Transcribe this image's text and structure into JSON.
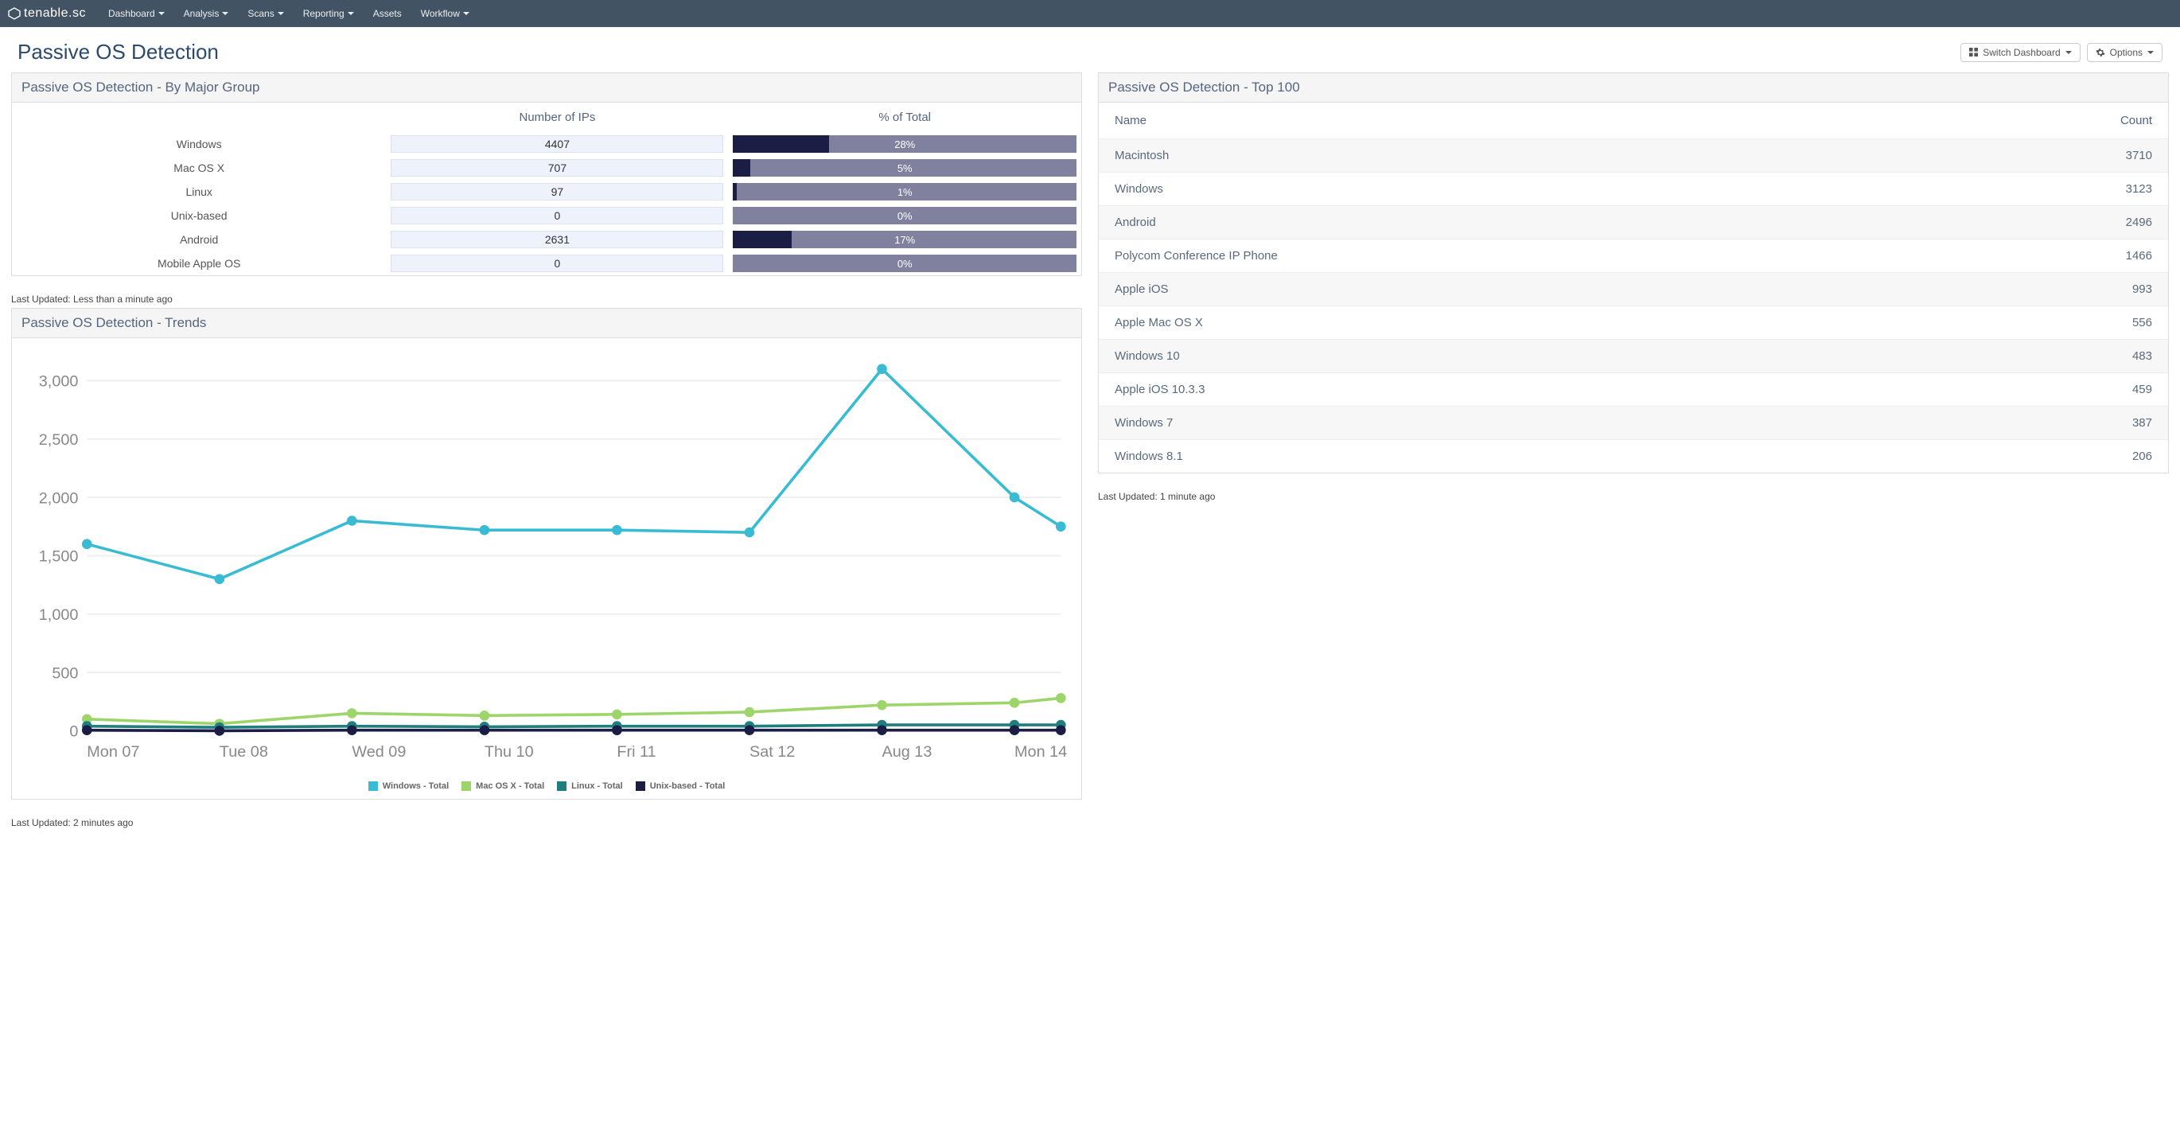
{
  "brand": "tenable.sc",
  "nav": [
    "Dashboard",
    "Analysis",
    "Scans",
    "Reporting",
    "Assets",
    "Workflow"
  ],
  "nav_has_caret": [
    true,
    true,
    true,
    true,
    false,
    true
  ],
  "page_title": "Passive OS Detection",
  "buttons": {
    "switch_dashboard": "Switch Dashboard",
    "options": "Options"
  },
  "panels": {
    "major_group_title": "Passive OS Detection - By Major Group",
    "trends_title": "Passive OS Detection - Trends",
    "top100_title": "Passive OS Detection - Top 100"
  },
  "major_group": {
    "col_ips": "Number of IPs",
    "col_pct": "% of Total",
    "rows": [
      {
        "label": "Windows",
        "ips": "4407",
        "pct": 28
      },
      {
        "label": "Mac OS X",
        "ips": "707",
        "pct": 5
      },
      {
        "label": "Linux",
        "ips": "97",
        "pct": 1
      },
      {
        "label": "Unix-based",
        "ips": "0",
        "pct": 0
      },
      {
        "label": "Android",
        "ips": "2631",
        "pct": 17
      },
      {
        "label": "Mobile Apple OS",
        "ips": "0",
        "pct": 0
      }
    ],
    "footer": "Last Updated: Less than a minute ago"
  },
  "chart_data": {
    "type": "line",
    "xlabel": "",
    "ylabel": "",
    "ylim": [
      0,
      3200
    ],
    "yticks": [
      0,
      500,
      1000,
      1500,
      2000,
      2500,
      3000
    ],
    "yticks_labels": [
      "0",
      "500",
      "1,000",
      "1,500",
      "2,000",
      "2,500",
      "3,000"
    ],
    "categories": [
      "Mon 07",
      "Tue 08",
      "Wed 09",
      "Thu 10",
      "Fri 11",
      "Sat 12",
      "Aug 13",
      "Mon 14"
    ],
    "x_extra_point_fraction": 0.35,
    "series": [
      {
        "name": "Windows - Total",
        "color": "#39bcd3",
        "values": [
          1600,
          1300,
          1800,
          1720,
          1720,
          1700,
          3100,
          2000
        ],
        "extra": 1750
      },
      {
        "name": "Mac OS X - Total",
        "color": "#9dd56a",
        "values": [
          100,
          60,
          150,
          130,
          140,
          160,
          220,
          240
        ],
        "extra": 280
      },
      {
        "name": "Linux - Total",
        "color": "#1f7f7f",
        "values": [
          40,
          30,
          40,
          35,
          40,
          40,
          50,
          50
        ],
        "extra": 50
      },
      {
        "name": "Unix-based - Total",
        "color": "#1b1d44",
        "values": [
          5,
          0,
          5,
          5,
          5,
          5,
          5,
          5
        ],
        "extra": 5
      }
    ]
  },
  "trends_footer": "Last Updated: 2 minutes ago",
  "top100": {
    "col_name": "Name",
    "col_count": "Count",
    "rows": [
      {
        "name": "Macintosh",
        "count": "3710"
      },
      {
        "name": "Windows",
        "count": "3123"
      },
      {
        "name": "Android",
        "count": "2496"
      },
      {
        "name": "Polycom Conference IP Phone",
        "count": "1466"
      },
      {
        "name": "Apple iOS",
        "count": "993"
      },
      {
        "name": "Apple Mac OS X",
        "count": "556"
      },
      {
        "name": "Windows 10",
        "count": "483"
      },
      {
        "name": "Apple iOS 10.3.3",
        "count": "459"
      },
      {
        "name": "Windows 7",
        "count": "387"
      },
      {
        "name": "Windows 8.1",
        "count": "206"
      }
    ],
    "footer": "Last Updated: 1 minute ago"
  }
}
